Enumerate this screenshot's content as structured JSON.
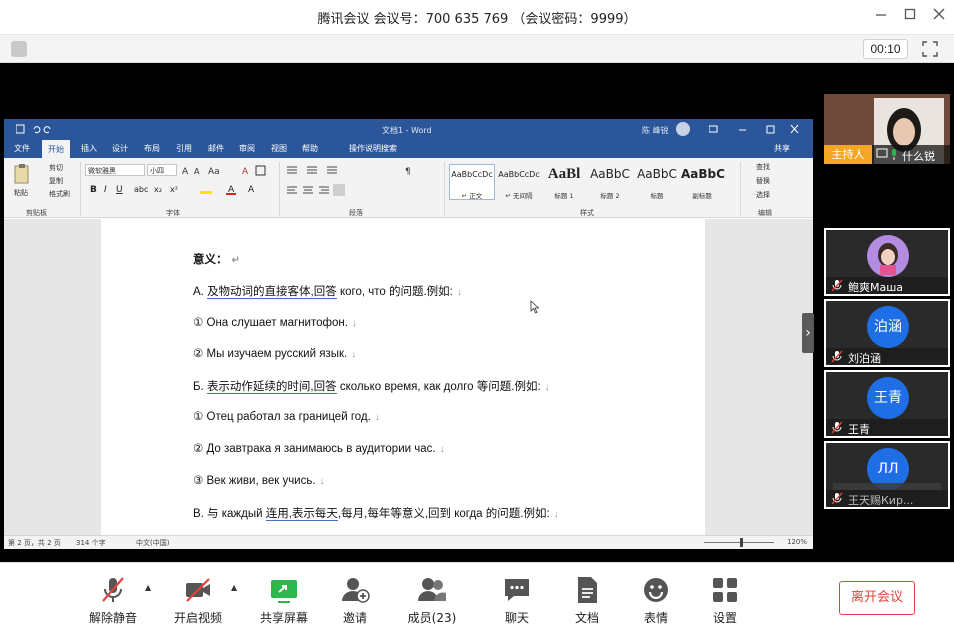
{
  "window": {
    "title": "腾讯会议 会议号：700 635 769 （会议密码：9999）",
    "timer": "00:10"
  },
  "word": {
    "doc_title": "文档1 - Word",
    "user": "陈 峰锐",
    "share": "共享",
    "tabs": [
      "文件",
      "开始",
      "插入",
      "设计",
      "布局",
      "引用",
      "邮件",
      "审阅",
      "视图",
      "帮助",
      "操作说明搜索"
    ],
    "ribbon": {
      "paste": "粘贴",
      "cut": "剪切",
      "copy": "复制",
      "format_painter": "格式刷",
      "font_name": "微软雅黑",
      "font_size": "小四",
      "group_clipboard": "剪贴板",
      "group_font": "字体",
      "group_paragraph": "段落",
      "group_styles": "样式",
      "group_editing": "编辑",
      "find": "查找",
      "replace": "替换",
      "select": "选择",
      "styles": [
        {
          "sample": "AaBbCcDc",
          "name": "↵ 正文"
        },
        {
          "sample": "AaBbCcDc",
          "name": "↵ 无间隔"
        },
        {
          "sample": "AaBl",
          "name": "标题 1"
        },
        {
          "sample": "AaBbC",
          "name": "标题 2"
        },
        {
          "sample": "AaBbC",
          "name": "标题"
        },
        {
          "sample": "AaBbC",
          "name": "副标题"
        }
      ]
    },
    "document": {
      "heading": "意义：",
      "line_a_pre": "А.  ",
      "line_a_link": "及物动词的直接客体,回答",
      "line_a_post": " кого, что 的问题.例如:",
      "ex1": "①  Она слушает магнитофон.",
      "ex2": "②  Мы изучаем русский язык.",
      "line_b_pre": "Б.  ",
      "line_b_link": "表示动作延续的时间,回答",
      "line_b_post": " сколько время, как долго 等问题.例如:",
      "ex3": "①  Отец работал за границей год.",
      "ex4": "②  До завтрака я занимаюсь в аудитории час.",
      "ex5": "③  Век живи, век учись.",
      "line_c_pre": "В.  与 каждый ",
      "line_c_link1": "连用,表示每天",
      "line_c_mid": ",每月,每年等意义,回到 когда 的问题.例如:"
    },
    "status": {
      "page": "第 2 页，共 2 页",
      "words": "314 个字",
      "language": "中文(中国)",
      "zoom": "120%"
    }
  },
  "participants": {
    "host_badge": "主持人",
    "host_name": "什么锐",
    "list": [
      {
        "name": "鲍爽Маша",
        "avatar": ""
      },
      {
        "name": "刘泊涵",
        "avatar": "泊涵"
      },
      {
        "name": "王青",
        "avatar": "王青"
      },
      {
        "name": "王天赐Кир...",
        "avatar": "ЛЛ"
      }
    ]
  },
  "toolbar": {
    "unmute": "解除静音",
    "start_video": "开启视频",
    "share_screen": "共享屏幕",
    "invite": "邀请",
    "members": "成员(23)",
    "chat": "聊天",
    "docs": "文档",
    "reactions": "表情",
    "settings": "设置",
    "leave": "离开会议"
  },
  "colors": {
    "word_blue": "#2b579a",
    "avatar_blue": "#1e6fe6",
    "host_orange": "#f5a623",
    "leave_red": "#e0433b",
    "share_green": "#2db84d"
  }
}
